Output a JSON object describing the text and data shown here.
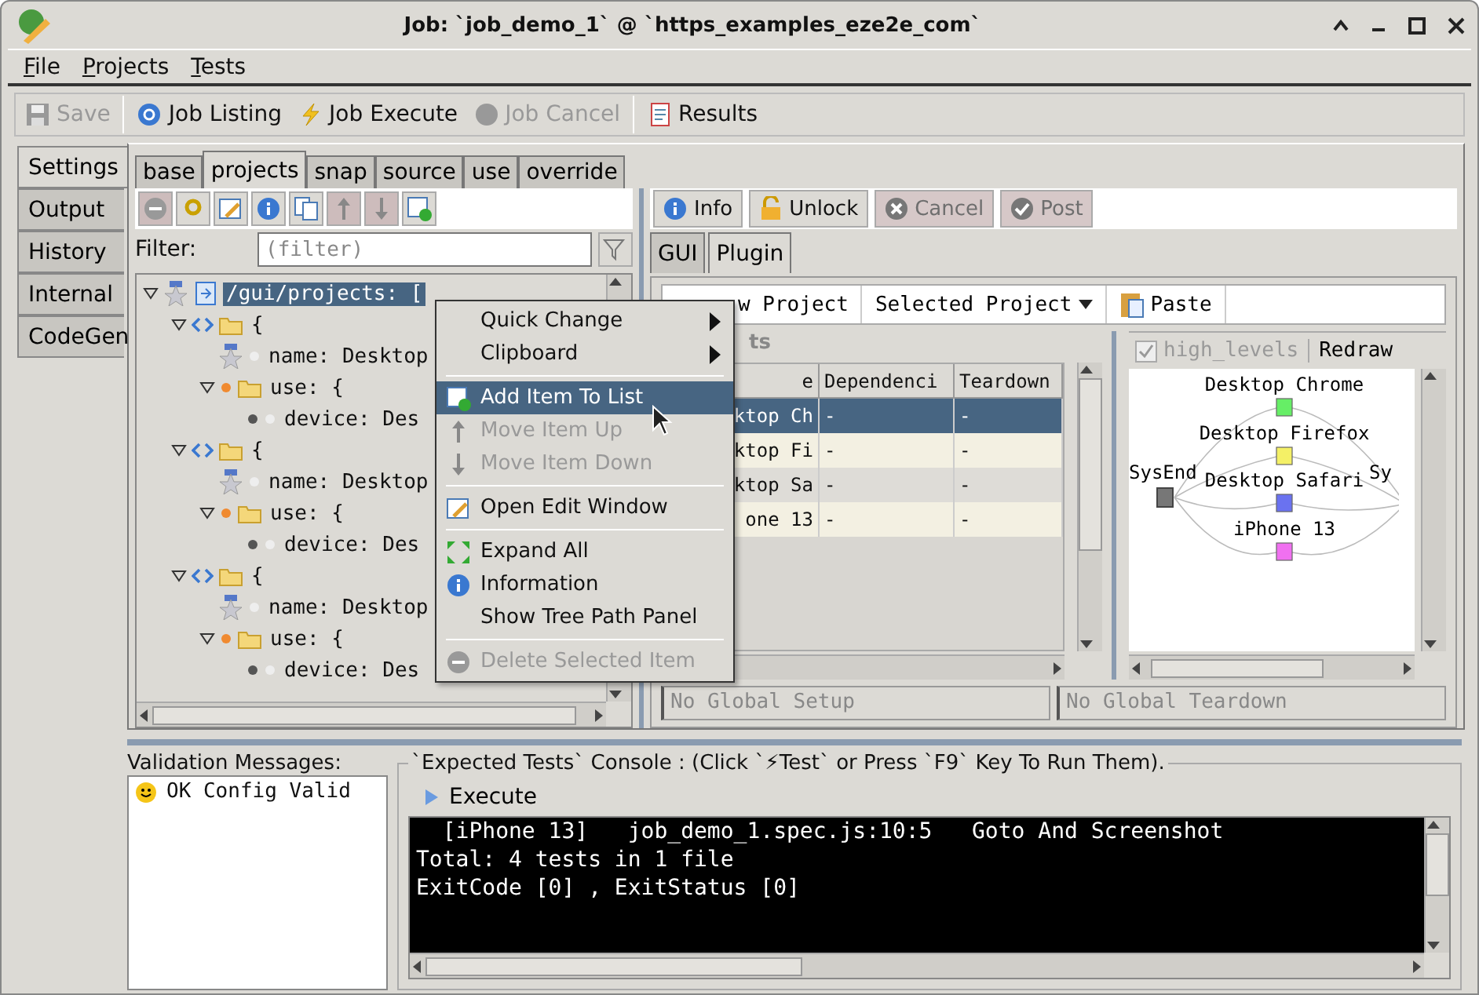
{
  "window": {
    "title": "Job: `job_demo_1` @ `https_examples_eze2e_com`"
  },
  "menu_bar": [
    {
      "label": "File"
    },
    {
      "label": "Projects"
    },
    {
      "label": "Tests"
    }
  ],
  "toolbar": [
    {
      "label": "Save",
      "disabled": true
    },
    {
      "label": "Job Listing",
      "disabled": false
    },
    {
      "label": "Job Execute",
      "disabled": false
    },
    {
      "label": "Job Cancel",
      "disabled": true
    },
    {
      "label": "Results",
      "disabled": false
    }
  ],
  "side_tabs": [
    {
      "label": "Settings",
      "selected": true
    },
    {
      "label": "Output",
      "selected": false
    },
    {
      "label": "History",
      "selected": false
    },
    {
      "label": "Internal",
      "selected": false
    },
    {
      "label": "CodeGen",
      "selected": false
    }
  ],
  "config_tabs": [
    {
      "label": "base",
      "selected": false
    },
    {
      "label": "projects",
      "selected": true
    },
    {
      "label": "snap",
      "selected": false
    },
    {
      "label": "source",
      "selected": false
    },
    {
      "label": "use",
      "selected": false
    },
    {
      "label": "override",
      "selected": false
    }
  ],
  "tree_tools": [
    {
      "disabled": true
    },
    {
      "disabled": false
    },
    {
      "disabled": false
    },
    {
      "disabled": false
    },
    {
      "disabled": false
    },
    {
      "disabled": true
    },
    {
      "disabled": true
    },
    {
      "disabled": false
    }
  ],
  "filter": {
    "label": "Filter:",
    "placeholder": "(filter)"
  },
  "tree": [
    {
      "text": "/gui/projects: [",
      "selected": true,
      "expanded": true,
      "children": [
        {
          "text": "{",
          "selected": false,
          "expanded": true,
          "children": [
            {
              "text": "name: Desktop",
              "selected": false
            },
            {
              "text": "use: {",
              "selected": false,
              "expanded": true,
              "children": [
                {
                  "text": "device: Des",
                  "selected": false
                }
              ]
            }
          ]
        },
        {
          "text": "{",
          "selected": false,
          "expanded": true,
          "children": [
            {
              "text": "name: Desktop",
              "selected": false
            },
            {
              "text": "use: {",
              "selected": false,
              "expanded": true,
              "children": [
                {
                  "text": "device: Des",
                  "selected": false
                }
              ]
            }
          ]
        },
        {
          "text": "{",
          "selected": false,
          "expanded": true,
          "children": [
            {
              "text": "name: Desktop",
              "selected": false
            },
            {
              "text": "use: {",
              "selected": false,
              "expanded": true,
              "children": [
                {
                  "text": "device: Des",
                  "selected": false
                }
              ]
            }
          ]
        }
      ]
    }
  ],
  "context_menu": [
    {
      "kind": "submenu",
      "label": "Quick Change",
      "selected": false,
      "disabled": false
    },
    {
      "kind": "submenu",
      "label": "Clipboard",
      "selected": false,
      "disabled": false
    },
    {
      "kind": "separator"
    },
    {
      "kind": "item",
      "label": "Add Item To List",
      "selected": true,
      "disabled": false
    },
    {
      "kind": "item",
      "label": "Move Item Up",
      "selected": false,
      "disabled": true
    },
    {
      "kind": "item",
      "label": "Move Item Down",
      "selected": false,
      "disabled": true
    },
    {
      "kind": "separator"
    },
    {
      "kind": "item",
      "label": "Open Edit Window",
      "selected": false,
      "disabled": false
    },
    {
      "kind": "separator"
    },
    {
      "kind": "item",
      "label": "Expand All",
      "selected": false,
      "disabled": false
    },
    {
      "kind": "item",
      "label": "Information",
      "selected": false,
      "disabled": false
    },
    {
      "kind": "item",
      "label": "Show Tree Path Panel",
      "selected": false,
      "disabled": false
    },
    {
      "kind": "separator"
    },
    {
      "kind": "item",
      "label": "Delete Selected Item",
      "selected": false,
      "disabled": true
    }
  ],
  "detail_toolbar": [
    {
      "label": "Info",
      "disabled": false
    },
    {
      "label": "Unlock",
      "disabled": false
    },
    {
      "label": "Cancel",
      "disabled": true
    },
    {
      "label": "Post",
      "disabled": true
    }
  ],
  "detail_tabs": [
    {
      "label": "GUI",
      "selected": false
    },
    {
      "label": "Plugin",
      "selected": true
    }
  ],
  "plugin_toolbar": [
    {
      "kind": "button",
      "label": "w Project"
    },
    {
      "kind": "dropdown",
      "label": "Selected Project"
    },
    {
      "kind": "paste",
      "label": "Paste"
    }
  ],
  "tests": {
    "title": "ts",
    "columns": [
      "e",
      "Dependenci",
      "Teardown"
    ],
    "rows": [
      {
        "cells": [
          "ktop Ch",
          "-",
          "-"
        ],
        "selected": true
      },
      {
        "cells": [
          "ktop Fi",
          "-",
          "-"
        ],
        "selected": false
      },
      {
        "cells": [
          "ktop Sa",
          "-",
          "-"
        ],
        "selected": false
      },
      {
        "cells": [
          "one 13",
          "-",
          "-"
        ],
        "selected": false
      }
    ]
  },
  "graph": {
    "checkbox": {
      "label": "high_levels",
      "checked": true
    },
    "redraw": "Redraw",
    "start": "SysEnd",
    "end": "Sy",
    "nodes": [
      {
        "label": "Desktop Chrome",
        "color": "#66ee66"
      },
      {
        "label": "Desktop Firefox",
        "color": "#f4f066"
      },
      {
        "label": "Desktop Safari",
        "color": "#6a72f0"
      },
      {
        "label": "iPhone 13",
        "color": "#f070f0"
      }
    ]
  },
  "global_setup": "No Global Setup",
  "global_teardown": "No Global Teardown",
  "validation": {
    "title": "Validation Messages:",
    "messages": [
      "OK Config Valid"
    ]
  },
  "console": {
    "title": "`Expected Tests` Console : (Click `⚡Test` or Press `F9` Key To Run Them).",
    "execute": "Execute",
    "lines": [
      "  [iPhone 13]   job_demo_1.spec.js:10:5   Goto And Screenshot",
      "Total: 4 tests in 1 file",
      "ExitCode [0] , ExitStatus [0]"
    ]
  }
}
